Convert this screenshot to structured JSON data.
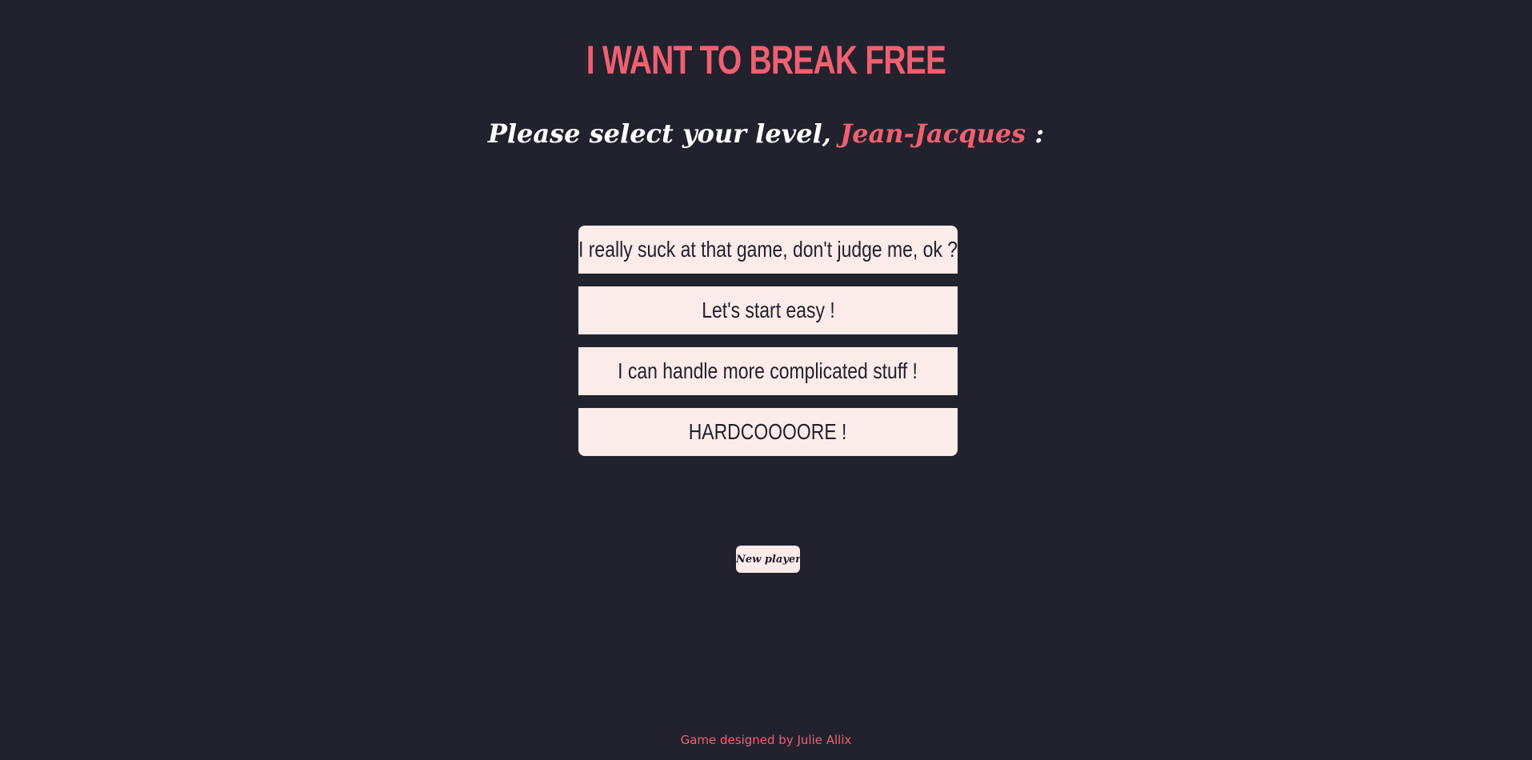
{
  "header": {
    "title": "I WANT TO BREAK FREE",
    "subtitle_prefix": "Please select your level, ",
    "player_name": "Jean-Jacques",
    "subtitle_suffix": " :"
  },
  "levels": [
    {
      "label": "I really suck at that game, don't judge me, ok ?"
    },
    {
      "label": "Let's start easy !"
    },
    {
      "label": "I can handle more complicated stuff !"
    },
    {
      "label": "HARDCOOOORE !"
    }
  ],
  "actions": {
    "new_player_label": "New player"
  },
  "footer": {
    "credit": "Game designed by Julie Allix"
  },
  "colors": {
    "background": "#22222e",
    "accent": "#ef6071",
    "button_bg": "#fbebe9",
    "text_dark": "#22222e",
    "text_light": "#ffffff"
  }
}
